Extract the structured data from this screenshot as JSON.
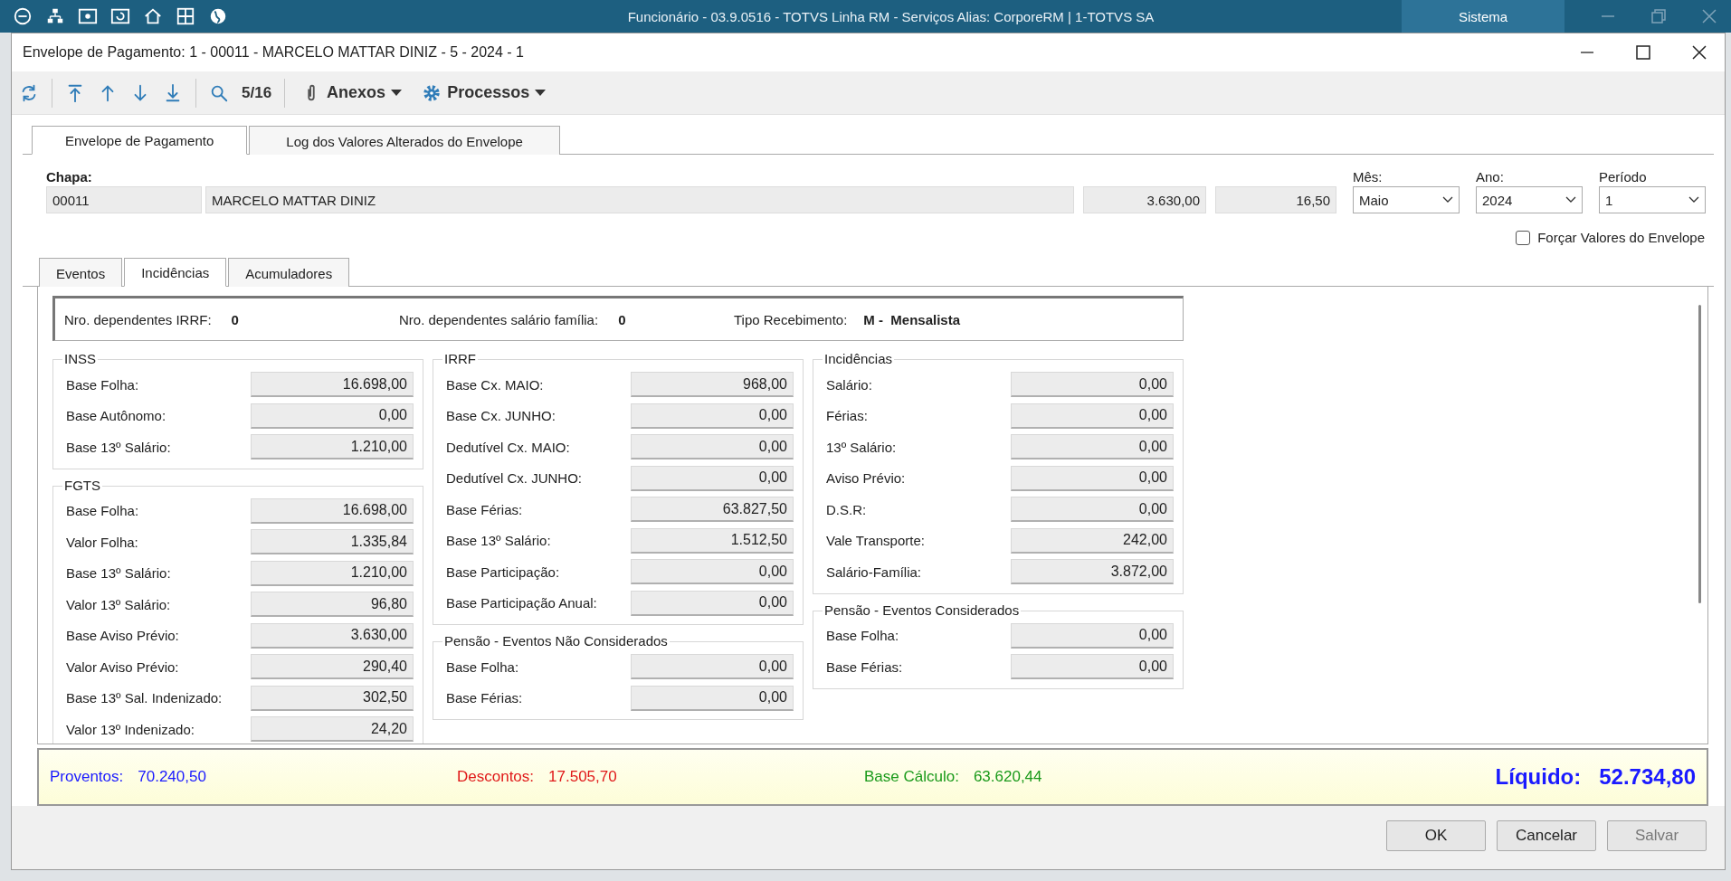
{
  "app_bar": {
    "title": "Funcionário - 03.9.0516 - TOTVS Linha RM - Serviços  Alias: CorporeRM | 1-TOTVS SA",
    "menu_label": "Sistema"
  },
  "dialog": {
    "title": "Envelope de Pagamento: 1 - 00011 - MARCELO MATTAR DINIZ - 5 - 2024 - 1"
  },
  "toolbar": {
    "counter": "5/16",
    "menus": [
      {
        "label": "Anexos",
        "kind": "clip"
      },
      {
        "label": "Processos",
        "kind": "gear"
      }
    ]
  },
  "tabs": [
    {
      "label": "Envelope de Pagamento",
      "selected": true
    },
    {
      "label": "Log dos Valores Alterados do Envelope",
      "selected": false
    }
  ],
  "header": {
    "chapa_label": "Chapa:",
    "chapa": "00011",
    "name": "MARCELO MATTAR DINIZ",
    "value_1": "3.630,00",
    "value_2": "16,50",
    "selects": [
      {
        "label": "Mês:",
        "value": "Maio"
      },
      {
        "label": "Ano:",
        "value": "2024"
      },
      {
        "label": "Período",
        "value": "1"
      }
    ],
    "force_checkbox": {
      "label": "Forçar Valores do Envelope",
      "checked": false
    }
  },
  "sub_tabs": [
    {
      "label": "Eventos",
      "selected": false
    },
    {
      "label": "Incidências",
      "selected": true
    },
    {
      "label": "Acumuladores",
      "selected": false
    }
  ],
  "info": [
    {
      "label": "Nro. dependentes IRRF:",
      "value": "0"
    },
    {
      "label": "Nro. dependentes salário família:",
      "value": "0"
    },
    {
      "label": "Tipo Recebimento:",
      "value": "M -  Mensalista"
    }
  ],
  "columns": [
    [
      {
        "title": "INSS",
        "rows": [
          {
            "label": "Base Folha:",
            "value": "16.698,00"
          },
          {
            "label": "Base Autônomo:",
            "value": "0,00"
          },
          {
            "label": "Base 13º Salário:",
            "value": "1.210,00"
          }
        ]
      },
      {
        "title": "FGTS",
        "rows": [
          {
            "label": "Base Folha:",
            "value": "16.698,00"
          },
          {
            "label": "Valor Folha:",
            "value": "1.335,84"
          },
          {
            "label": "Base 13º Salário:",
            "value": "1.210,00"
          },
          {
            "label": "Valor 13º Salário:",
            "value": "96,80"
          },
          {
            "label": "Base Aviso Prévio:",
            "value": "3.630,00"
          },
          {
            "label": "Valor Aviso Prévio:",
            "value": "290,40"
          },
          {
            "label": "Base 13º Sal. Indenizado:",
            "value": "302,50"
          },
          {
            "label": "Valor 13º Indenizado:",
            "value": "24,20"
          }
        ]
      }
    ],
    [
      {
        "title": "IRRF",
        "rows": [
          {
            "label": "Base Cx. MAIO:",
            "value": "968,00"
          },
          {
            "label": "Base Cx. JUNHO:",
            "value": "0,00"
          },
          {
            "label": "Dedutível Cx. MAIO:",
            "value": "0,00"
          },
          {
            "label": "Dedutível Cx. JUNHO:",
            "value": "0,00"
          },
          {
            "label": "Base Férias:",
            "value": "63.827,50"
          },
          {
            "label": "Base 13º Salário:",
            "value": "1.512,50"
          },
          {
            "label": "Base Participação:",
            "value": "0,00"
          },
          {
            "label": "Base Participação Anual:",
            "value": "0,00"
          }
        ]
      },
      {
        "title": "Pensão - Eventos Não Considerados",
        "rows": [
          {
            "label": "Base Folha:",
            "value": "0,00"
          },
          {
            "label": "Base Férias:",
            "value": "0,00"
          }
        ]
      }
    ],
    [
      {
        "title": "Incidências",
        "rows": [
          {
            "label": "Salário:",
            "value": "0,00"
          },
          {
            "label": "Férias:",
            "value": "0,00"
          },
          {
            "label": "13º Salário:",
            "value": "0,00"
          },
          {
            "label": "Aviso Prévio:",
            "value": "0,00"
          },
          {
            "label": "D.S.R:",
            "value": "0,00"
          },
          {
            "label": "Vale Transporte:",
            "value": "242,00"
          },
          {
            "label": "Salário-Família:",
            "value": "3.872,00"
          }
        ]
      },
      {
        "title": "Pensão - Eventos Considerados",
        "rows": [
          {
            "label": "Base Folha:",
            "value": "0,00"
          },
          {
            "label": "Base Férias:",
            "value": "0,00"
          }
        ]
      }
    ]
  ],
  "summary": [
    {
      "label": "Proventos:",
      "value": "70.240,50",
      "color": "#1a1aff"
    },
    {
      "label": "Descontos:",
      "value": "17.505,70",
      "color": "#e01818"
    },
    {
      "label": "Base Cálculo:",
      "value": "63.620,44",
      "color": "#1a9a1a"
    }
  ],
  "liquido": {
    "label": "Líquido:",
    "value": "52.734,80"
  },
  "buttons": [
    {
      "label": "OK",
      "disabled": false
    },
    {
      "label": "Cancelar",
      "disabled": false
    },
    {
      "label": "Salvar",
      "disabled": true
    }
  ]
}
